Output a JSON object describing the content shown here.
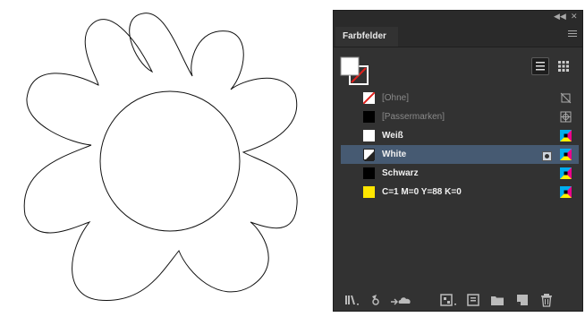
{
  "panel": {
    "tab_label": "Farbfelder",
    "menu_icon": "panel-menu-icon",
    "view_modes": [
      "list-view-icon",
      "grid-view-icon"
    ]
  },
  "swatches": [
    {
      "label": "[Ohne]",
      "color": "none",
      "icon": "no-print-icon",
      "dim": true
    },
    {
      "label": "[Passermarken]",
      "color": "#000000",
      "icon": "registration-icon",
      "dim": true
    },
    {
      "label": "Weiß",
      "color": "#ffffff",
      "icon": "cmyk-icon",
      "dim": false
    },
    {
      "label": "White",
      "color": "#ffffff",
      "icon": "cmyk-icon",
      "dim": false,
      "selected": true,
      "spot": true
    },
    {
      "label": "Schwarz",
      "color": "#000000",
      "icon": "cmyk-icon",
      "dim": false
    },
    {
      "label": "C=1 M=0 Y=88 K=0",
      "color": "#ffe600",
      "icon": "cmyk-icon",
      "dim": false
    }
  ],
  "colors": {
    "panel_bg": "#323232",
    "selection": "#465a72",
    "cyan": "#00aeef",
    "magenta": "#ec008c",
    "yellow": "#fff200"
  }
}
